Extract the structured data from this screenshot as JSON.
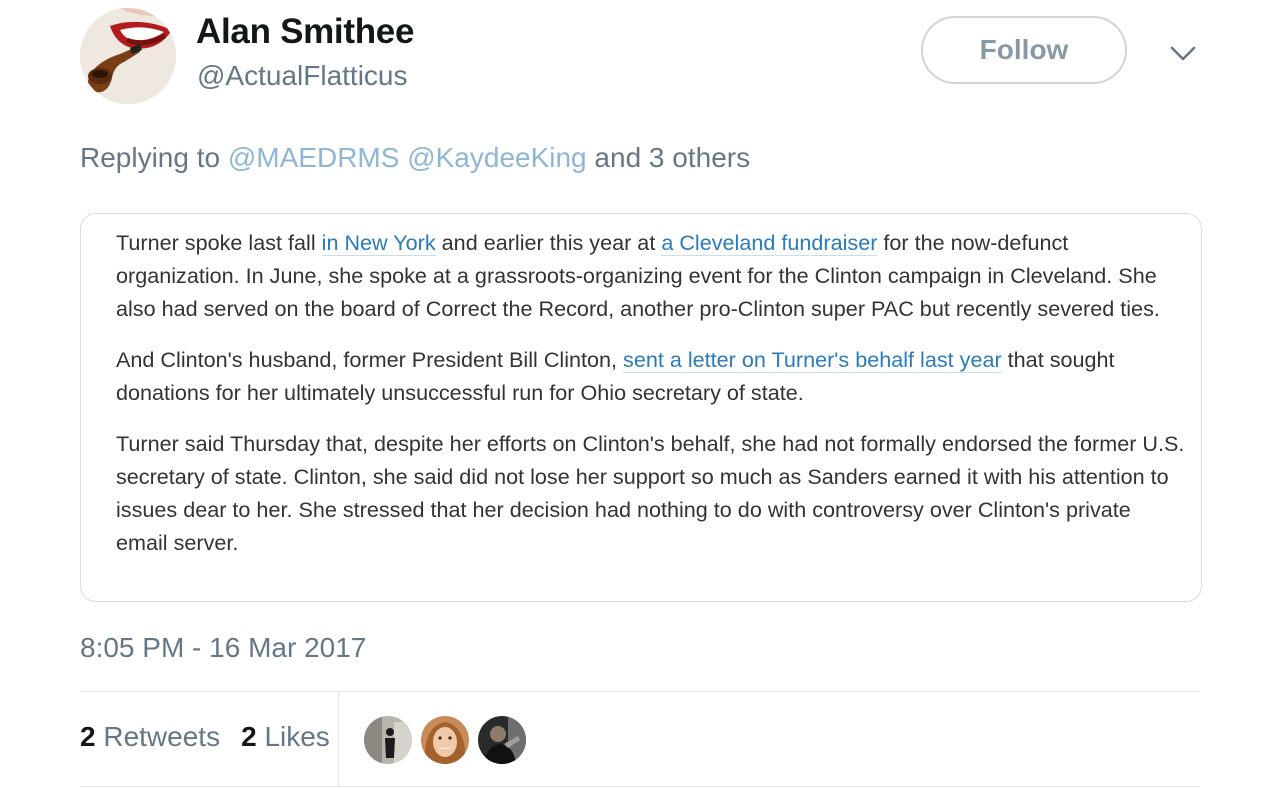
{
  "user": {
    "display_name": "Alan Smithee",
    "handle": "@ActualFlatticus",
    "avatar_icon": "pipe-smoking-mouth-avatar"
  },
  "follow_button": {
    "label": "Follow"
  },
  "menu_caret": {
    "icon": "chevron-down-icon"
  },
  "replying": {
    "prefix": "Replying to",
    "mention_1": "@MAEDRMS",
    "mention_2": "@KaydeeKing",
    "suffix": "and 3 others"
  },
  "quote": {
    "p1": {
      "t1": "Turner spoke last fall ",
      "link1": "in New York",
      "t2": " and earlier this year at ",
      "link2": "a Cleveland fundraiser",
      "t3": " for the now-defunct organization. In June, she spoke at a grassroots-organizing event for the Clinton campaign in Cleveland. She also had served on the board of Correct the Record, another pro-Clinton super PAC but recently severed ties."
    },
    "p2": {
      "t1": "And Clinton's husband, former President Bill Clinton, ",
      "link1": "sent a letter on Turner's behalf last year",
      "t2": " that sought donations for her ultimately unsuccessful run for Ohio secretary of state."
    },
    "p3": {
      "t1": "Turner said Thursday that, despite her efforts on Clinton's behalf, she had not formally endorsed the former U.S. secretary of state. Clinton, she said did not lose her support so much as Sanders earned it with his attention to issues dear to her. She stressed that her decision had nothing to do with controversy over Clinton's private email server."
    }
  },
  "timestamp": "8:05 PM - 16 Mar 2017",
  "stats": {
    "retweets_count": "2",
    "retweets_label": "Retweets",
    "likes_count": "2",
    "likes_label": "Likes"
  },
  "likers": [
    {
      "icon": "liker-avatar-silhouette"
    },
    {
      "icon": "liker-avatar-woman"
    },
    {
      "icon": "liker-avatar-dark"
    }
  ],
  "colors": {
    "link": "#2b7bb9",
    "secondary_text": "#657786",
    "primary_text": "#14171a",
    "border": "#e1e8ed"
  }
}
